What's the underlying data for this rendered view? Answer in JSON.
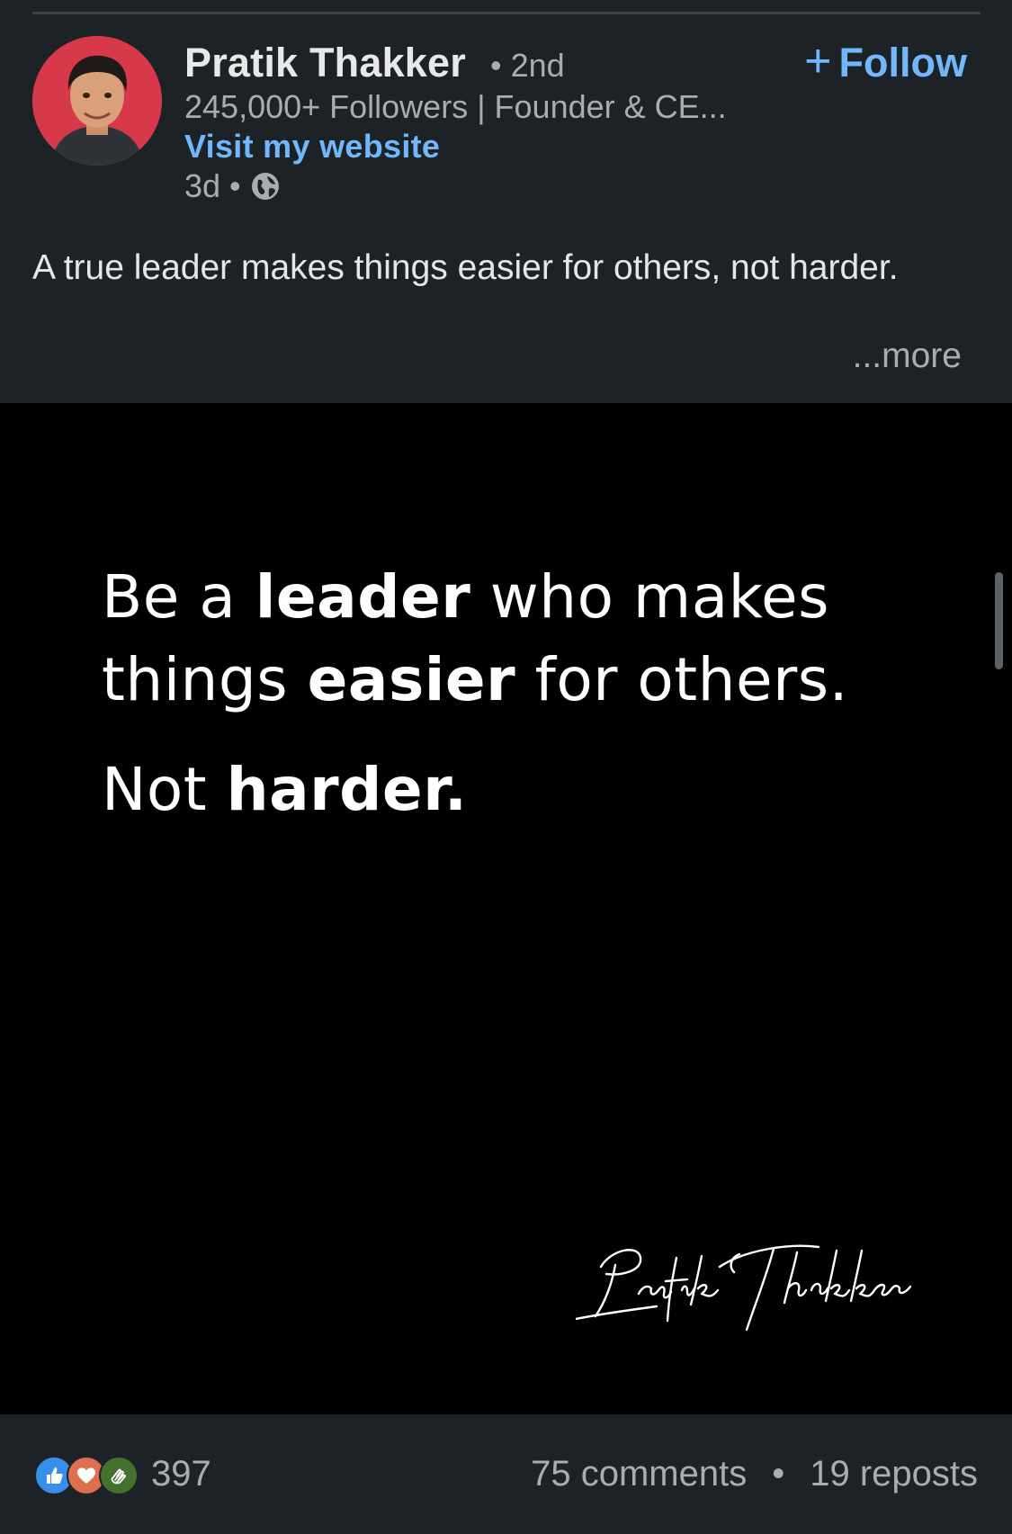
{
  "author": {
    "name": "Pratik Thakker",
    "degree": "2nd",
    "headline": "245,000+ Followers | Founder & CE...",
    "website_link": "Visit my website",
    "time_ago": "3d",
    "follow_label": "Follow",
    "avatar_bg": "#d8394a"
  },
  "post": {
    "text": "A true leader makes things easier for others, not harder.",
    "more_label": "...more"
  },
  "image": {
    "quote_line1_a": "Be a ",
    "quote_line1_bold": "leader",
    "quote_line1_b": " who makes",
    "quote_line2_a": "things ",
    "quote_line2_bold": "easier",
    "quote_line2_b": " for others.",
    "quote_line3_a": "Not ",
    "quote_line3_bold": "harder.",
    "signature_text": "Pratik Thakker"
  },
  "footer": {
    "reaction_count": "397",
    "comments": "75 comments",
    "separator": "•",
    "reposts": "19 reposts",
    "reaction_icons": [
      "like-icon",
      "love-icon",
      "clap-icon"
    ]
  },
  "colors": {
    "background": "#1d2226",
    "link": "#71b7fb",
    "muted": "#a9adb1"
  }
}
